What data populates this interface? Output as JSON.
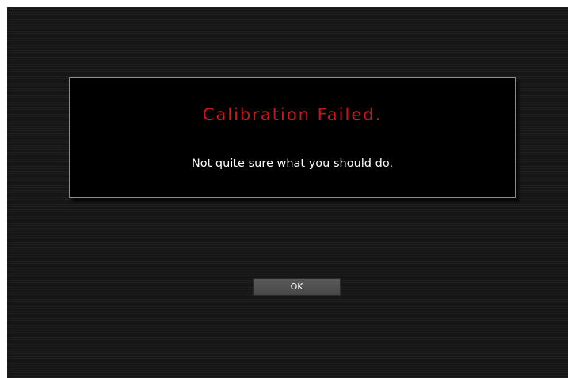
{
  "dialog": {
    "title": "Calibration Failed.",
    "message": "Not quite sure what you should do."
  },
  "buttons": {
    "ok_label": "OK"
  },
  "colors": {
    "title": "#d0141b",
    "message": "#ffffff",
    "background": "#1b1b1b",
    "dialog_background": "#000000",
    "dialog_border": "#8c8c8c",
    "button": "#505050"
  }
}
